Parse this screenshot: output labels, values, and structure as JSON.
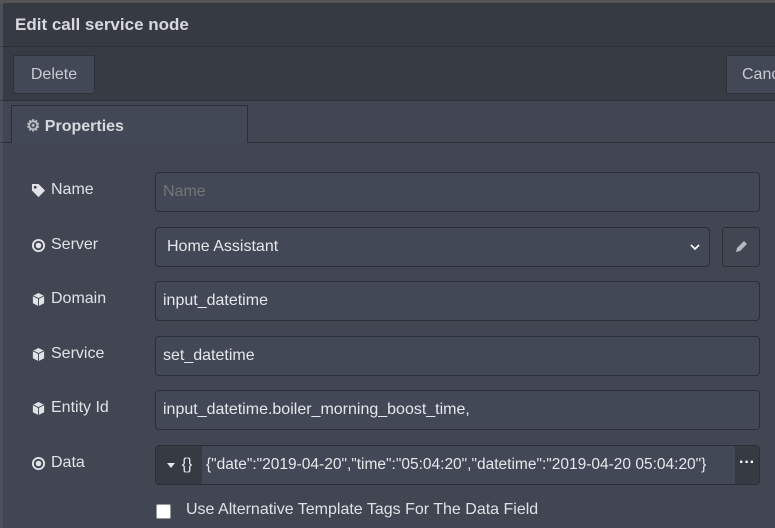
{
  "dialog": {
    "title": "Edit call service node"
  },
  "toolbar": {
    "delete_label": "Delete",
    "cancel_label": "Cancel"
  },
  "tabs": [
    {
      "label": "Properties",
      "icon": "gear-icon"
    }
  ],
  "form": {
    "name": {
      "label": "Name",
      "value": "",
      "placeholder": "Name",
      "icon": "tag-icon"
    },
    "server": {
      "label": "Server",
      "value": "Home Assistant",
      "icon": "dot-circle-icon"
    },
    "domain": {
      "label": "Domain",
      "value": "input_datetime",
      "icon": "cube-icon"
    },
    "service": {
      "label": "Service",
      "value": "set_datetime",
      "icon": "cube-icon"
    },
    "entity_id": {
      "label": "Entity Id",
      "value": "input_datetime.boiler_morning_boost_time,",
      "icon": "cube-icon"
    },
    "data": {
      "label": "Data",
      "type_symbol": "{}",
      "value": "{\"date\":\"2019-04-20\",\"time\":\"05:04:20\",\"datetime\":\"2019-04-20 05:04:20\"}",
      "more": "···",
      "icon": "dot-circle-icon"
    },
    "alt_tags": {
      "label": "Use Alternative Template Tags For The Data Field",
      "checked": false
    }
  }
}
